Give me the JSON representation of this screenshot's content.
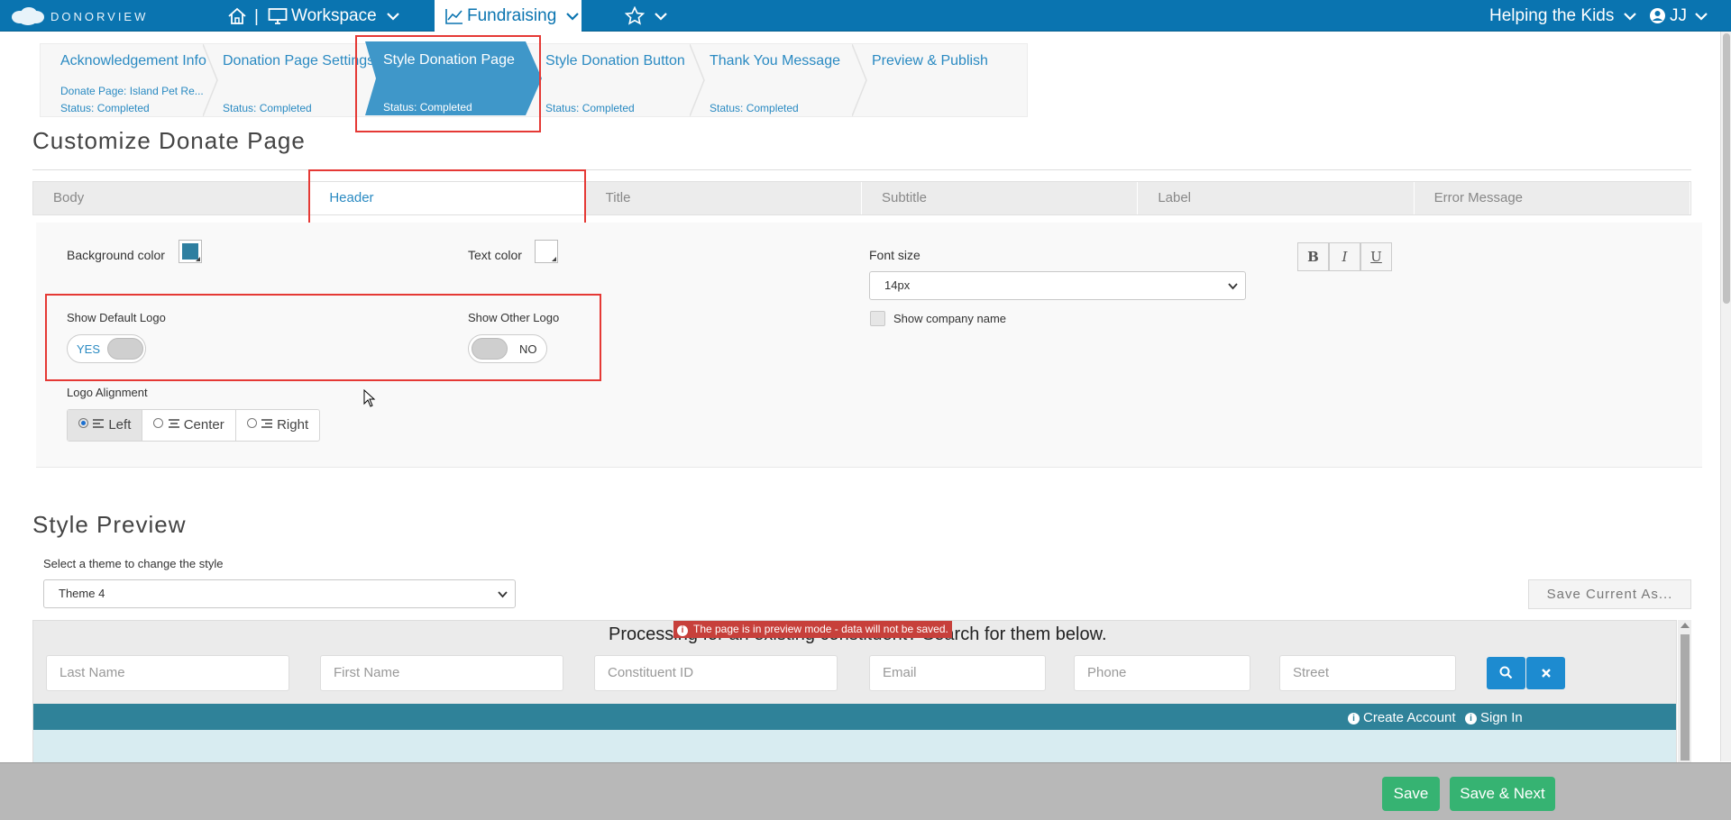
{
  "nav": {
    "brand": "DONORVIEW",
    "separator": "|",
    "workspace": "Workspace",
    "fundraising": "Fundraising",
    "org": "Helping the Kids",
    "user": "JJ",
    "icons": [
      "home-icon",
      "monitor-icon",
      "chart-line-icon",
      "star-icon",
      "user-circle-icon",
      "chevron-down-icon"
    ],
    "bar_color": "#0a74b0"
  },
  "steps": [
    {
      "name": "Acknowledgement Info",
      "sub": "Donate Page: Island Pet Re...",
      "status": "Status: Completed"
    },
    {
      "name": "Donation Page Settings",
      "sub": "",
      "status": "Status: Completed"
    },
    {
      "name": "Style Donation Page",
      "sub": "",
      "status": "Status: Completed",
      "active": true
    },
    {
      "name": "Style Donation Button",
      "sub": "",
      "status": "Status: Completed"
    },
    {
      "name": "Thank You Message",
      "sub": "",
      "status": "Status: Completed"
    },
    {
      "name": "Preview & Publish",
      "sub": "",
      "status": ""
    }
  ],
  "customize": {
    "title": "Customize Donate Page",
    "tabs": [
      "Body",
      "Header",
      "Title",
      "Subtitle",
      "Label",
      "Error Message"
    ],
    "active_tab": "Header"
  },
  "header_settings": {
    "background_color_label": "Background color",
    "background_color": "#2e7fa0",
    "text_color_label": "Text color",
    "text_color": "#ffffff",
    "font_size_label": "Font size",
    "font_size": "14px",
    "format_buttons": [
      "B",
      "I",
      "U"
    ],
    "show_company_name": "Show company name",
    "show_default_logo": {
      "label": "Show Default Logo",
      "value": "YES"
    },
    "show_other_logo": {
      "label": "Show Other Logo",
      "value": "NO"
    },
    "logo_alignment": {
      "label": "Logo Alignment",
      "options": [
        "Left",
        "Center",
        "Right"
      ],
      "selected": "Left"
    }
  },
  "preview": {
    "title": "Style Preview",
    "theme_label": "Select a theme to change the style",
    "theme": "Theme 4",
    "save_as": "Save Current As...",
    "processing_text": "Processing for an existing constituent? Search for them below.",
    "notice": "The page is in preview mode - data will not be saved.",
    "search_placeholders": [
      "Last Name",
      "First Name",
      "Constituent ID",
      "Email",
      "Phone",
      "Street"
    ],
    "create_account": "Create Account",
    "sign_in": "Sign In",
    "bar_color": "#2f8299"
  },
  "footer": {
    "save": "Save",
    "save_next": "Save & Next",
    "button_color": "#36b372"
  }
}
